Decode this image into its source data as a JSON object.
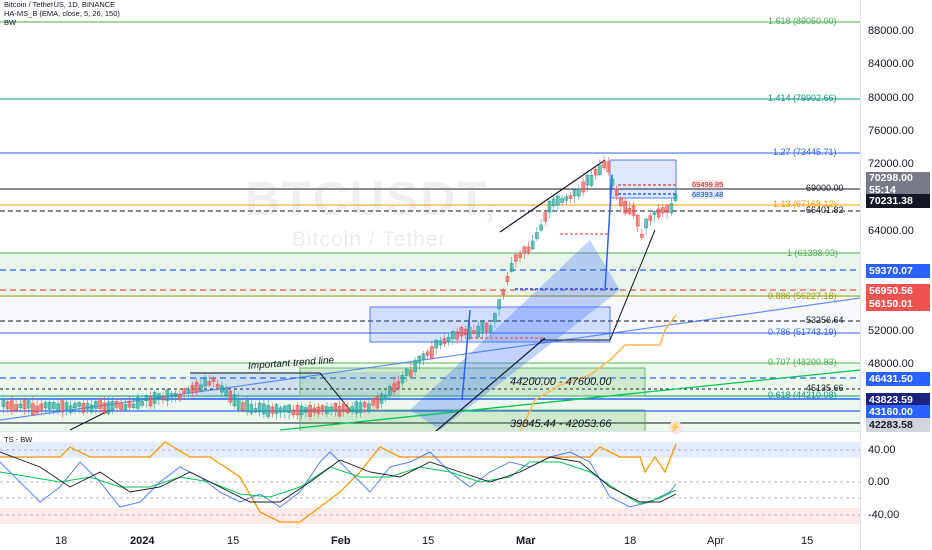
{
  "header": {
    "title": "Bitcoin / TetherUS, 1D, BINANCE",
    "indicator1": "HA-MS_B (EMA, close, 5, 26, 150)",
    "indicator2": "BW"
  },
  "watermark": {
    "symbol": "BTCUSDT,",
    "name": "Bitcoin / Tether"
  },
  "price_axis_ticks": [
    "88000.00",
    "84000.00",
    "80000.00",
    "76000.00",
    "72000.00",
    "64000.00",
    "52000.00",
    "48000.00"
  ],
  "price_labels": {
    "current": "70298.00",
    "countdown": "55:14",
    "p1": "70231.38",
    "p2": "59370.07",
    "p3": "56950.56",
    "p4": "56150.01",
    "p5": "46431.50",
    "p6": "43823.59",
    "p7": "43160.00",
    "p8": "42283.58"
  },
  "fib_levels": [
    {
      "label": "1.618 (89050.00)",
      "color": "#4caf50"
    },
    {
      "label": "1.414 (79902.66)",
      "color": "#089981"
    },
    {
      "label": "1.27 (73445.71)",
      "color": "#2962ff"
    },
    {
      "label": "1.13 (67168.12)",
      "color": "#ff9800"
    },
    {
      "label": "1 (61338.93)",
      "color": "#4caf50"
    },
    {
      "label": "0.886 (56227.18)",
      "color": "#9c9c00"
    },
    {
      "label": "0.786 (51743.19)",
      "color": "#2962ff"
    },
    {
      "label": "0.707 (48200.83)",
      "color": "#4caf50"
    },
    {
      "label": "0.618 (44210.08)",
      "color": "#089981"
    }
  ],
  "level_texts": {
    "l69000": "69000.00",
    "l66401": "66401.82",
    "l53256": "53256.64",
    "l45135": "45135.66",
    "box_a": "69499.85",
    "box_b": "68393.48"
  },
  "annotations": {
    "trend": "Important trend line",
    "range1": "44200.00 - 47600.00",
    "range2": "39845.44 - 42053.66"
  },
  "oscillator": {
    "title": "TS - BW",
    "ticks": [
      "40.00",
      "0.00",
      "-40.00"
    ]
  },
  "x_axis": [
    "18",
    "2024",
    "15",
    "Feb",
    "15",
    "Mar",
    "18",
    "Apr",
    "15"
  ],
  "colors": {
    "bull": "#26a69a",
    "bear": "#ef5350",
    "blue": "#2962ff",
    "green": "#4caf50",
    "orange": "#ff9800"
  }
}
